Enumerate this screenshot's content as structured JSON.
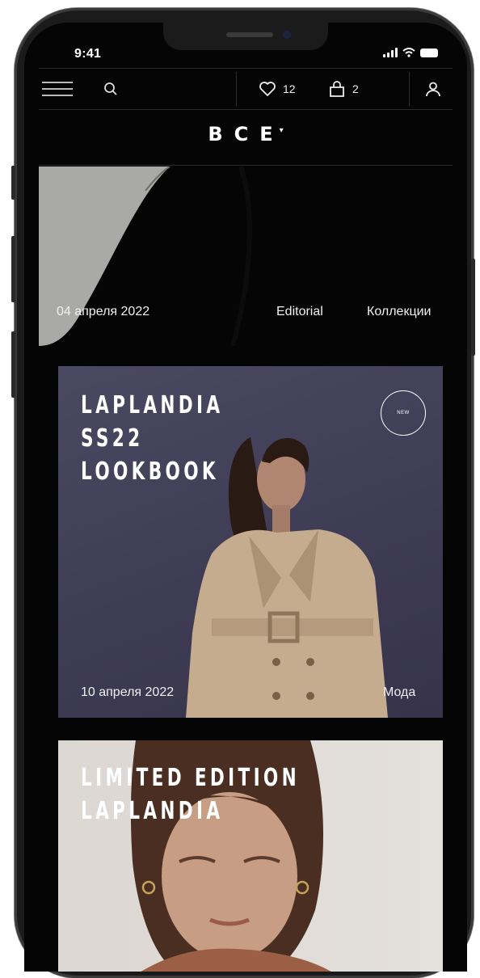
{
  "status_bar": {
    "time": "9:41"
  },
  "nav": {
    "wishlist_count": "12",
    "cart_count": "2"
  },
  "filter": {
    "label": "ВСЕ",
    "caret": "▾"
  },
  "articles": [
    {
      "date": "04 апреля 2022",
      "tag1": "Editorial",
      "tag2": "Коллекции"
    },
    {
      "title_lines": "LAPLANDIA\nSS22\nLOOKBOOK",
      "badge": "NEW",
      "date": "10 апреля 2022",
      "tag": "Мода"
    },
    {
      "title_lines": "LIMITED EDITION\nLAPLANDIA"
    }
  ],
  "colors": {
    "background": "#050505",
    "text": "#ffffff",
    "card_purple": "#444159",
    "card_grey": "#dcd7d2"
  },
  "icons": [
    "menu-icon",
    "search-icon",
    "heart-icon",
    "bag-icon",
    "user-icon",
    "chevron-down-icon"
  ]
}
